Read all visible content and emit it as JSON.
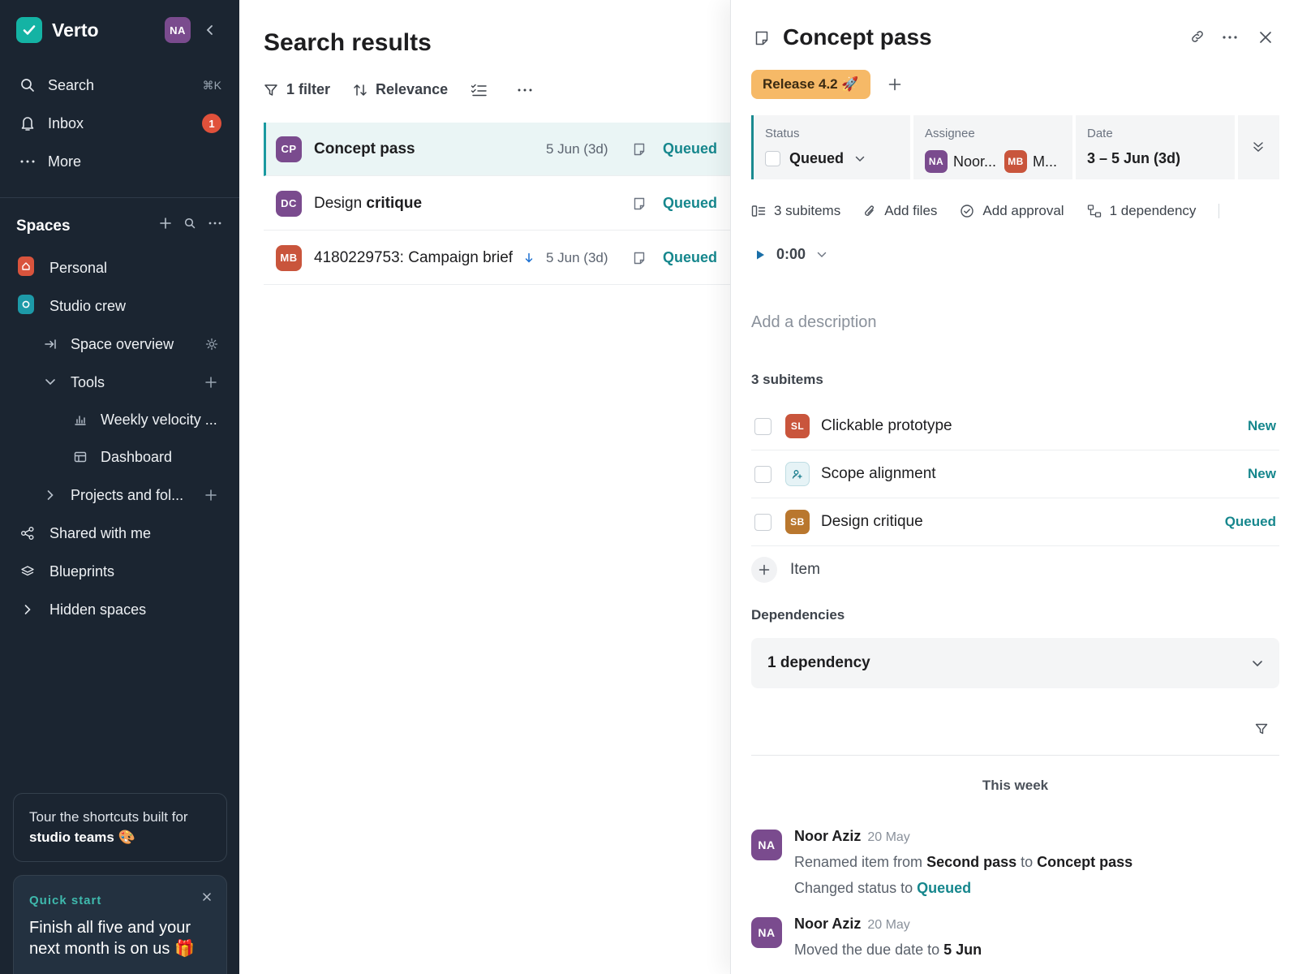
{
  "app": {
    "name": "Verto",
    "user_initials": "NA"
  },
  "sidebar": {
    "search": {
      "label": "Search",
      "shortcut": "⌘K"
    },
    "inbox": {
      "label": "Inbox",
      "count": "1"
    },
    "more": {
      "label": "More"
    },
    "spaces_title": "Spaces",
    "spaces": {
      "personal": "Personal",
      "studio": "Studio crew",
      "overview": "Space overview",
      "tools": "Tools",
      "weekly": "Weekly velocity ...",
      "dashboard": "Dashboard",
      "projects": "Projects and fol...",
      "shared": "Shared with me",
      "blueprints": "Blueprints",
      "hidden": "Hidden spaces"
    },
    "promo": {
      "line1": "Tour the shortcuts built for",
      "line2": "studio teams 🎨"
    },
    "quick_start": {
      "label": "Quick start",
      "text": "Finish all five and your next month is on us 🎁"
    }
  },
  "results": {
    "title": "Search results",
    "filter_label": "1 filter",
    "sort_label": "Relevance",
    "rows": [
      {
        "initials": "CP",
        "title": "Concept pass",
        "date": "5 Jun (3d)",
        "status": "Queued",
        "color": "#7a4b8e"
      },
      {
        "initials": "DC",
        "title_plain": "Design ",
        "title_bold": "critique",
        "date": "",
        "status": "Queued",
        "color": "#7a4b8e"
      },
      {
        "initials": "MB",
        "title": "4180229753: Campaign brief",
        "date": "5 Jun (3d)",
        "status": "Queued",
        "color": "#c9553c"
      }
    ]
  },
  "detail": {
    "title": "Concept pass",
    "release": "Release 4.2 🚀",
    "status": {
      "label": "Status",
      "value": "Queued"
    },
    "assignee": {
      "label": "Assignee",
      "a1_initials": "NA",
      "a1_name": "Noor...",
      "a2_initials": "MB",
      "a2_name": "M..."
    },
    "date": {
      "label": "Date",
      "value": "3 – 5 Jun (3d)"
    },
    "chips": {
      "subitems": "3 subitems",
      "files": "Add files",
      "approval": "Add approval",
      "dependency": "1 dependency"
    },
    "timer": "0:00",
    "description_placeholder": "Add a description",
    "subitems_title": "3 subitems",
    "subitems": [
      {
        "initials": "SL",
        "title": "Clickable prototype",
        "status": "New",
        "color": "#c9553c"
      },
      {
        "initials": "",
        "title": "Scope alignment",
        "status": "New",
        "color": "#e6f3f6"
      },
      {
        "initials": "SB",
        "title": "Design critique",
        "status": "Queued",
        "color": "#b9772e"
      }
    ],
    "add_item": "Item",
    "dependencies_title": "Dependencies",
    "dependency_box": "1 dependency",
    "activity": {
      "week_label": "This week",
      "entries": [
        {
          "initials": "NA",
          "name": "Noor Aziz",
          "time": "20 May",
          "l1_pre": "Renamed item from ",
          "l1_from": "Second pass",
          "l1_mid": " to ",
          "l1_to": "Concept pass",
          "l2_pre": "Changed status to ",
          "l2_status": "Queued"
        },
        {
          "initials": "NA",
          "name": "Noor Aziz",
          "time": "20 May",
          "l1_pre": "Moved the due date to ",
          "l1_date": "5 Jun"
        }
      ]
    }
  },
  "colors": {
    "accent": "#16878d",
    "sidebar_bg": "#1b2531",
    "release_bg": "#f6b967",
    "badge": "#e0513b"
  }
}
